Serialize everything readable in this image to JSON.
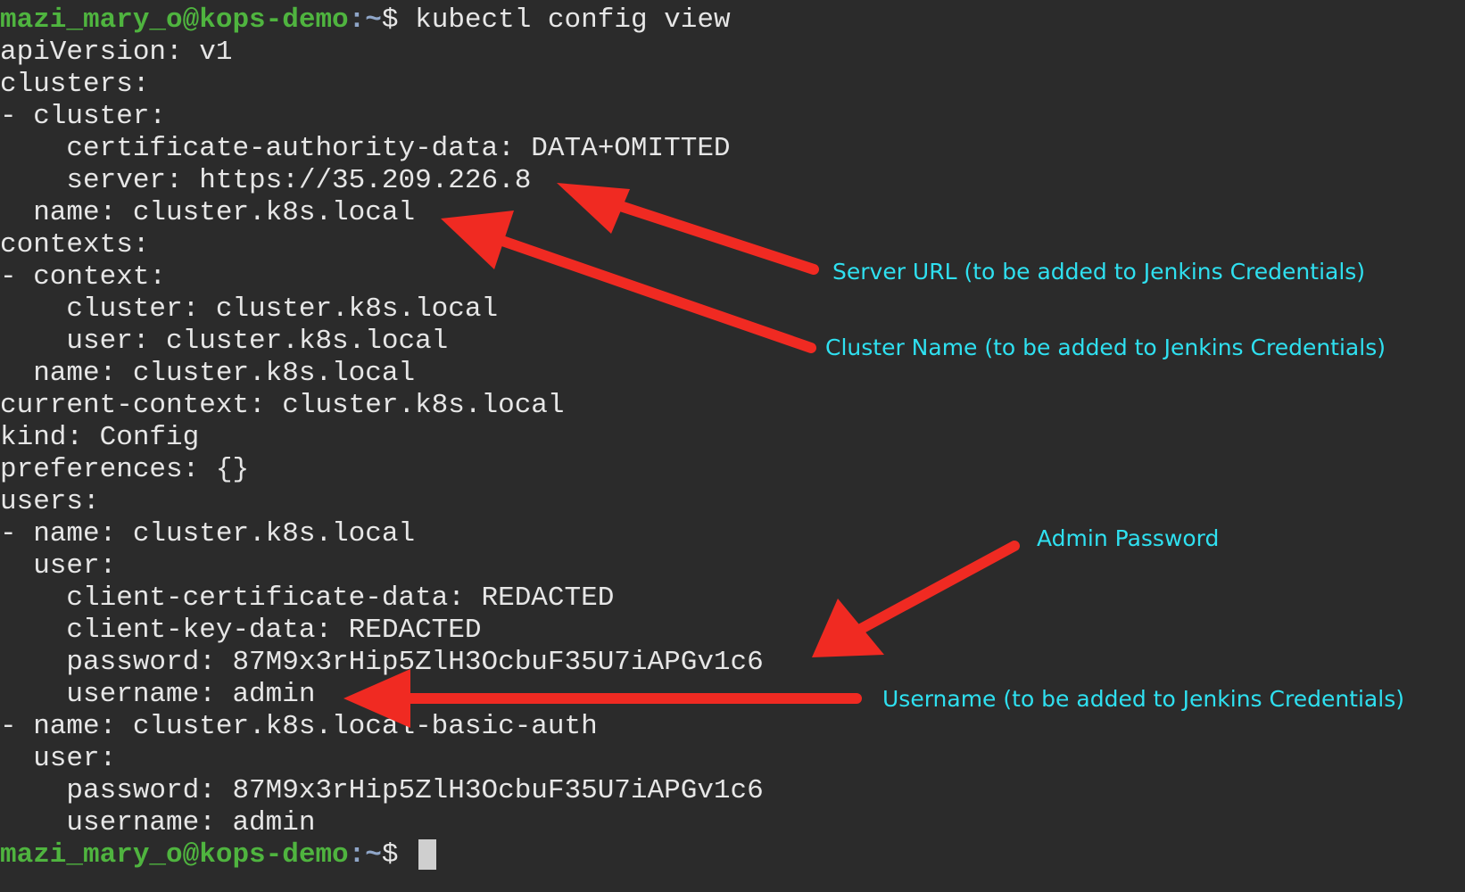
{
  "terminal": {
    "prompt": {
      "user_host": "mazi_mary_o@kops-demo",
      "path": ":~",
      "sign": "$ "
    },
    "command": "kubectl config view",
    "output_lines": [
      "apiVersion: v1",
      "clusters:",
      "- cluster:",
      "    certificate-authority-data: DATA+OMITTED",
      "    server: https://35.209.226.8",
      "  name: cluster.k8s.local",
      "contexts:",
      "- context:",
      "    cluster: cluster.k8s.local",
      "    user: cluster.k8s.local",
      "  name: cluster.k8s.local",
      "current-context: cluster.k8s.local",
      "kind: Config",
      "preferences: {}",
      "users:",
      "- name: cluster.k8s.local",
      "  user:",
      "    client-certificate-data: REDACTED",
      "    client-key-data: REDACTED",
      "    password: 87M9x3rHip5ZlH3OcbuF35U7iAPGv1c6",
      "    username: admin",
      "- name: cluster.k8s.local-basic-auth",
      "  user:",
      "    password: 87M9x3rHip5ZlH3OcbuF35U7iAPGv1c6",
      "    username: admin"
    ]
  },
  "annotations": {
    "server_url": "Server URL (to be added to Jenkins Credentials)",
    "cluster_name": "Cluster Name (to be added to Jenkins Credentials)",
    "admin_password": "Admin Password",
    "username": "Username (to be added to Jenkins Credentials)"
  },
  "colors": {
    "background": "#2b2b2b",
    "text": "#e6e6e6",
    "prompt_user": "#4fb43f",
    "prompt_path": "#8fa6c8",
    "annotation_text": "#2fe0f0",
    "arrow": "#f02a22"
  }
}
